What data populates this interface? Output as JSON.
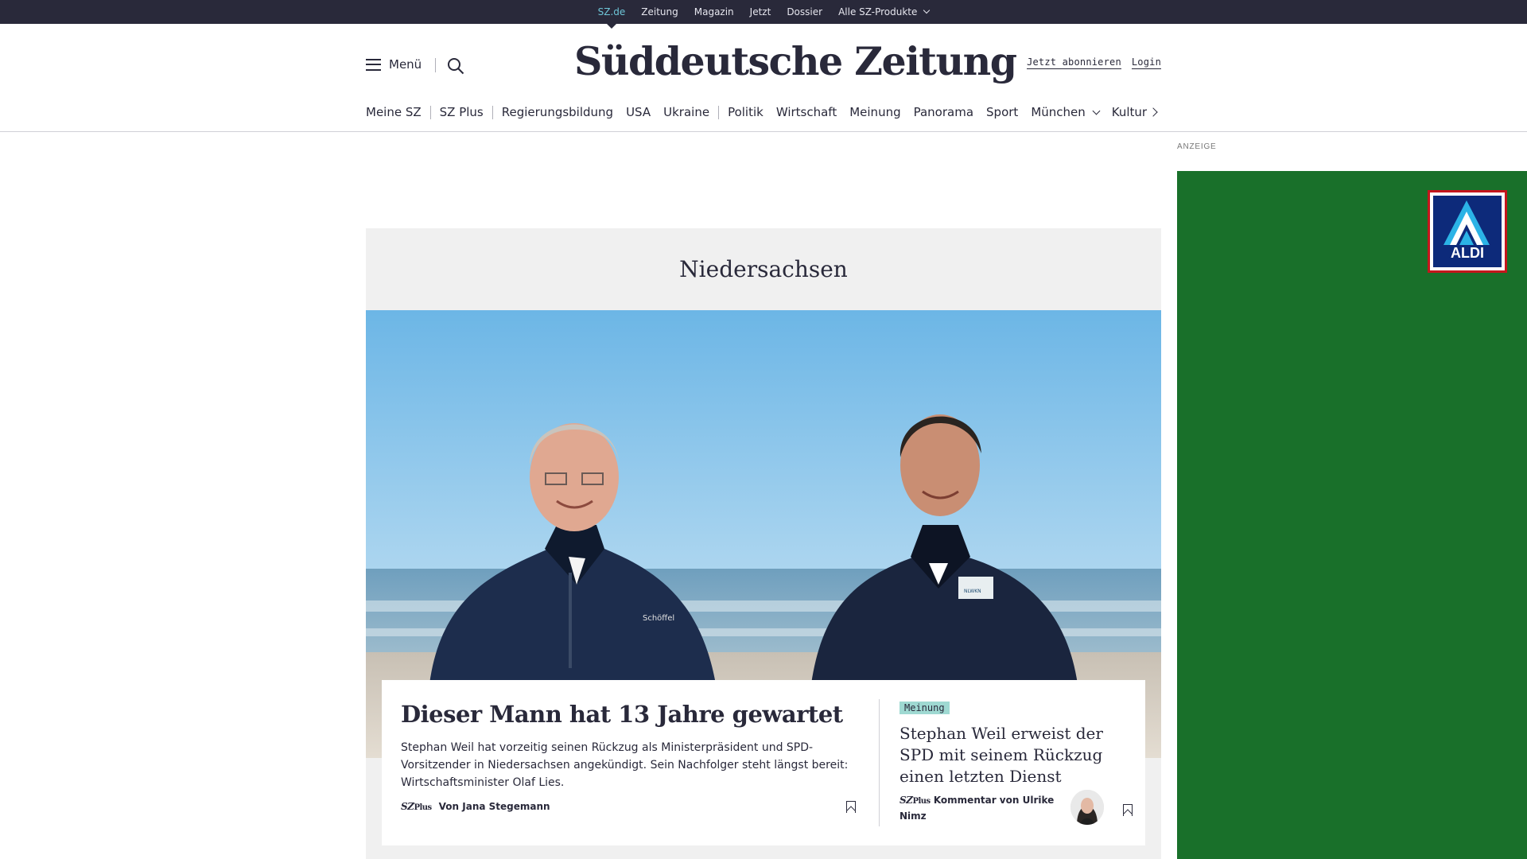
{
  "topbar": {
    "links": [
      "SZ.de",
      "Zeitung",
      "Magazin",
      "Jetzt",
      "Dossier",
      "Alle SZ-Produkte"
    ]
  },
  "header": {
    "menu_label": "Menü",
    "logo": "Süddeutsche Zeitung",
    "subscribe": "Jetzt abonnieren",
    "login": "Login"
  },
  "nav": {
    "items": [
      "Meine SZ",
      "SZ Plus",
      "Regierungsbildung",
      "USA",
      "Ukraine",
      "Politik",
      "Wirtschaft",
      "Meinung",
      "Panorama",
      "Sport",
      "München",
      "Kultur"
    ]
  },
  "ad": {
    "label": "ANZEIGE",
    "brand": "ALDI"
  },
  "section": {
    "title": "Niedersachsen"
  },
  "lead": {
    "headline": "Dieser Mann hat 13 Jahre gewartet",
    "text": "Stephan Weil hat vorzeitig seinen Rückzug als Ministerpräsident und SPD-Vorsitzender in Niedersachsen angekündigt. Sein Nachfolger steht längst bereit: Wirtschaftsminister Olaf Lies.",
    "plus_label": "SZ",
    "plus_suffix": "Plus",
    "author": "Von Jana Stegemann",
    "jacket_left": "Schöffel",
    "jacket_right": "NLWKN"
  },
  "opinion": {
    "badge": "Meinung",
    "headline": "Stephan Weil erweist der SPD mit seinem Rückzug einen letzten Dienst",
    "plus_label": "SZ",
    "plus_suffix": "Plus",
    "author": "Kommentar von Ulrike Nimz"
  },
  "colors": {
    "topbar": "#29293a",
    "accent": "#6ec6d8",
    "ad_green": "#19702a",
    "badge": "#9fd9d2"
  }
}
